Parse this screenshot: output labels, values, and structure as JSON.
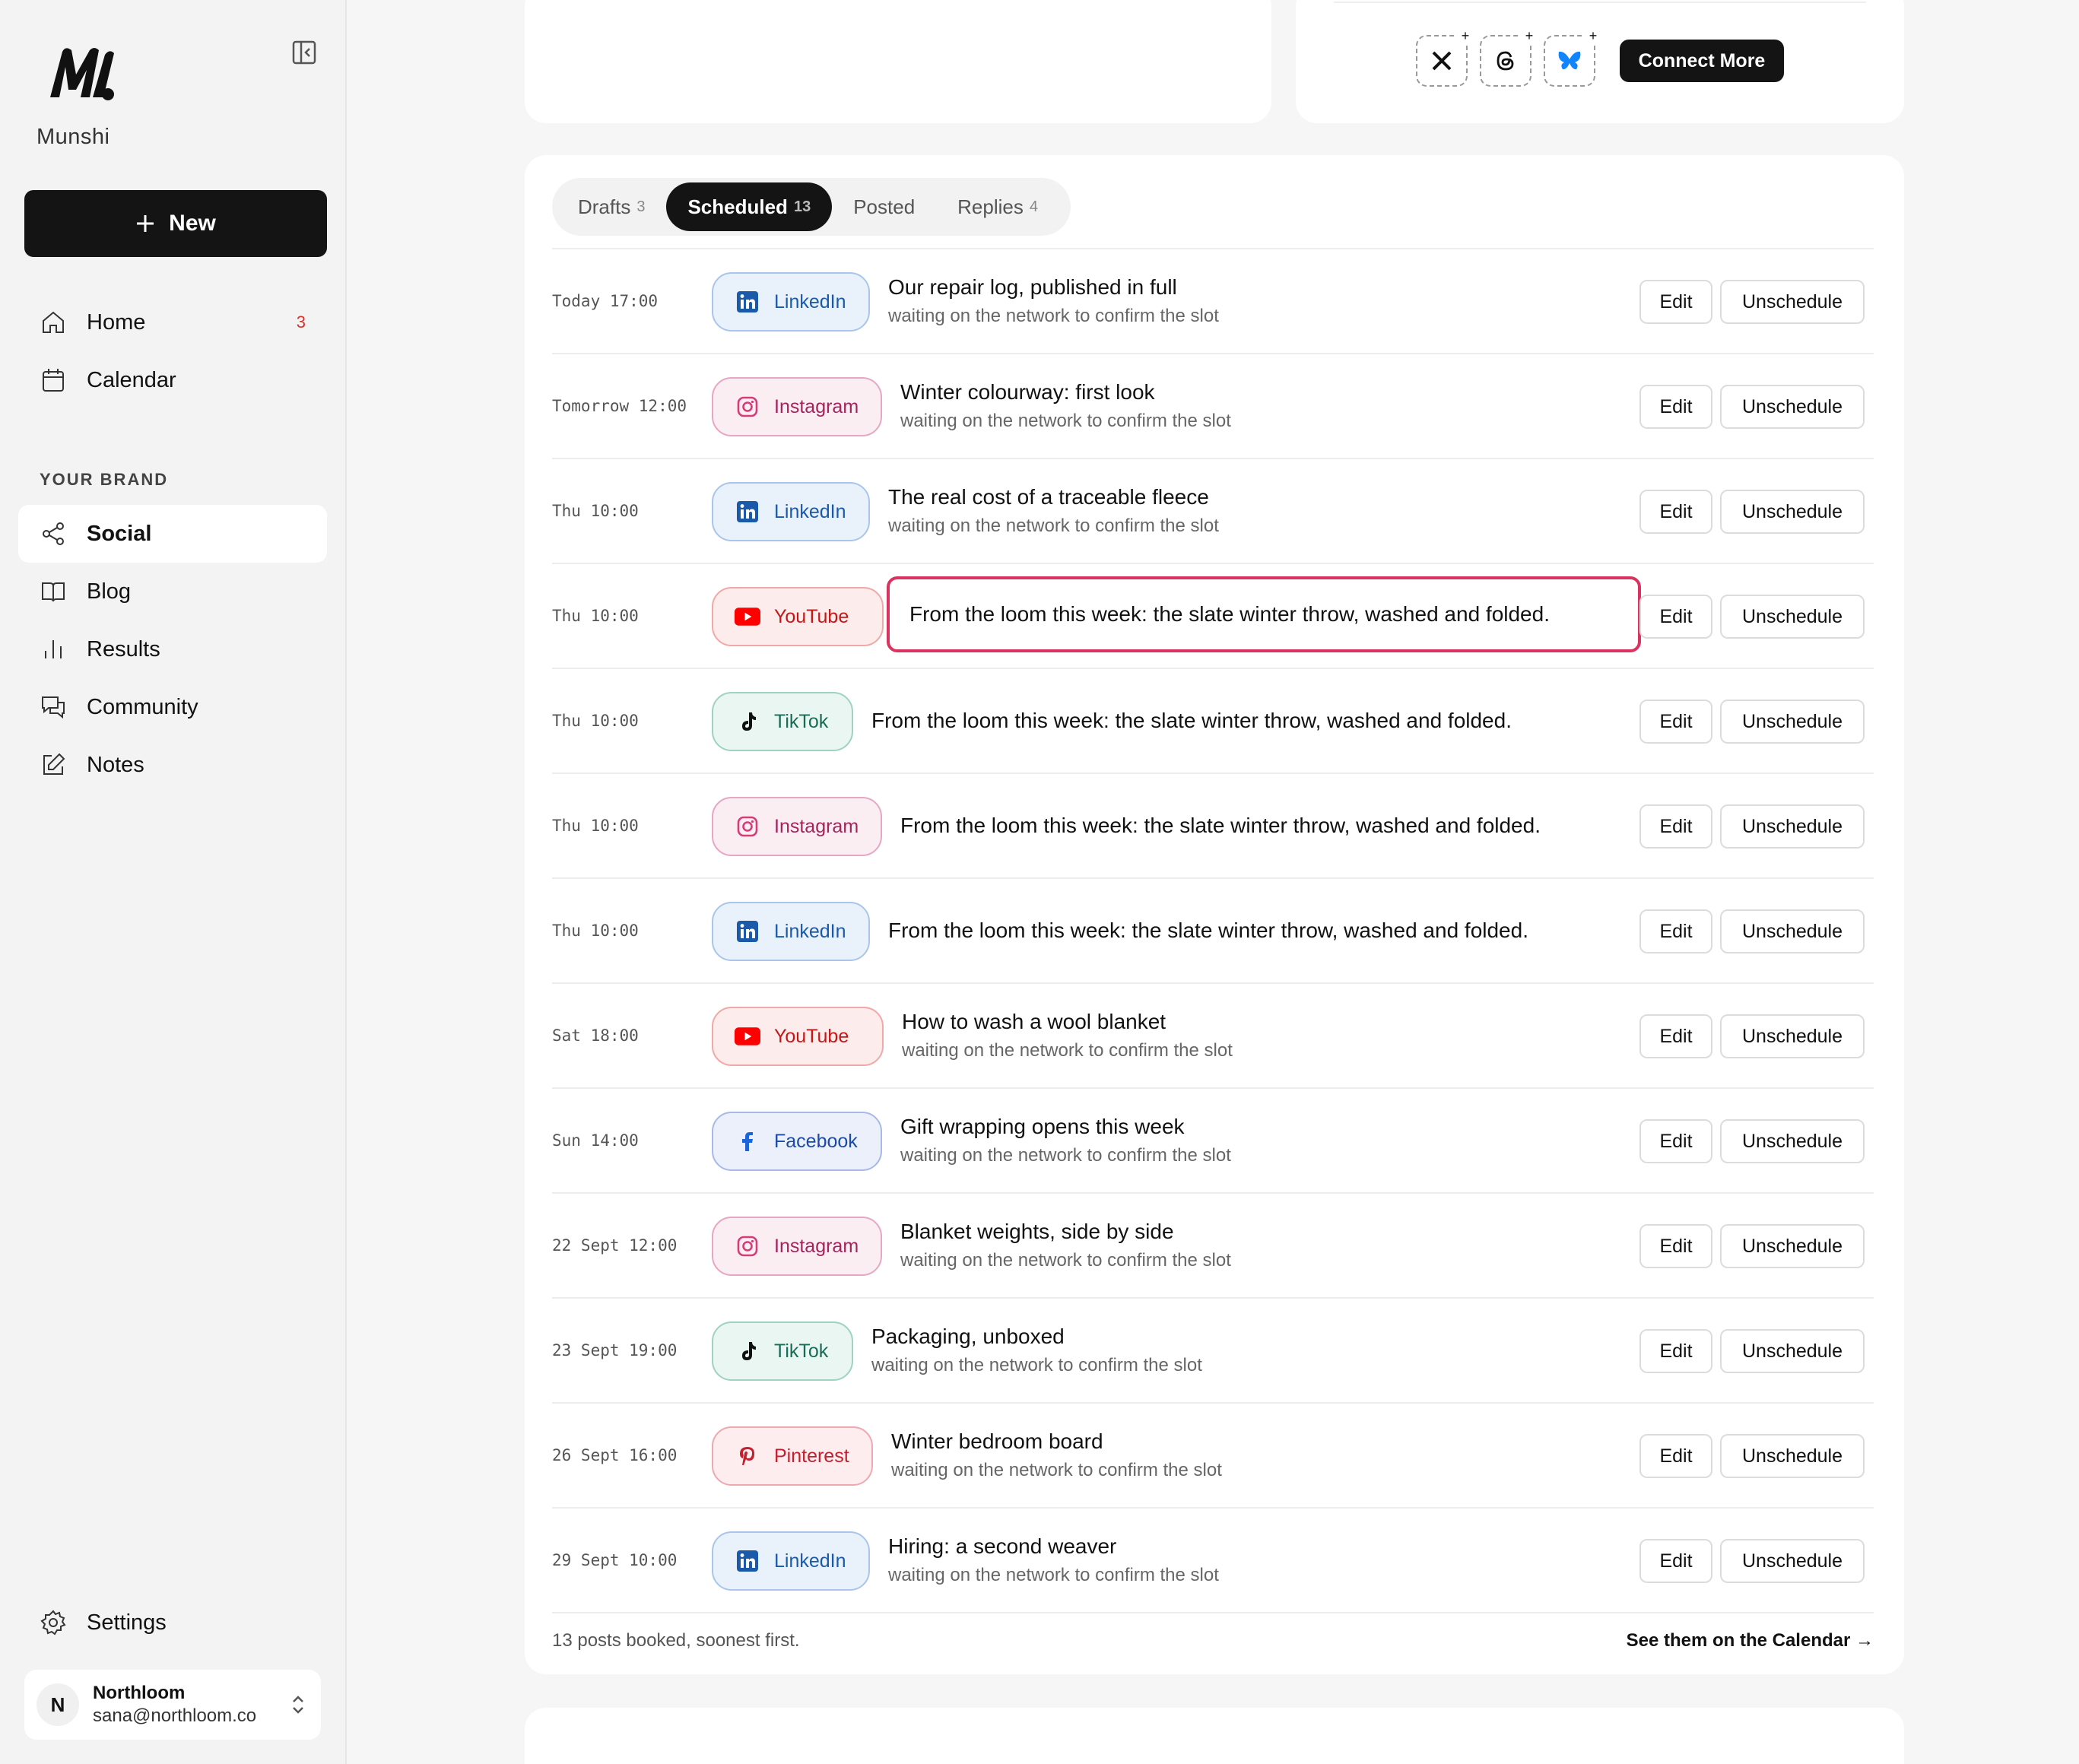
{
  "sidebar": {
    "brand": "Munshi",
    "new_label": "New",
    "nav": [
      {
        "label": "Home",
        "icon": "home-icon",
        "badge": "3"
      },
      {
        "label": "Calendar",
        "icon": "calendar-icon",
        "badge": ""
      }
    ],
    "section_label": "YOUR BRAND",
    "brand_nav": [
      {
        "label": "Social",
        "icon": "share-icon",
        "active": true
      },
      {
        "label": "Blog",
        "icon": "book-icon"
      },
      {
        "label": "Results",
        "icon": "bar-chart-icon"
      },
      {
        "label": "Community",
        "icon": "chat-icon"
      },
      {
        "label": "Notes",
        "icon": "edit-icon"
      }
    ],
    "settings_label": "Settings",
    "account": {
      "initial": "N",
      "name": "Northloom",
      "email": "sana@northloom.co"
    }
  },
  "connect": {
    "button_label": "Connect More",
    "slots": [
      "x-icon",
      "threads-icon",
      "bluesky-icon"
    ]
  },
  "tabs": [
    {
      "label": "Drafts",
      "count": "3"
    },
    {
      "label": "Scheduled",
      "count": "13",
      "active": true
    },
    {
      "label": "Posted",
      "count": ""
    },
    {
      "label": "Replies",
      "count": "4"
    }
  ],
  "rows": [
    {
      "time": "Today 17:00",
      "network": "LinkedIn",
      "title": "Our repair log, published in full",
      "sub": "waiting on the network to confirm the slot"
    },
    {
      "time": "Tomorrow 12:00",
      "network": "Instagram",
      "title": "Winter colourway: first look",
      "sub": "waiting on the network to confirm the slot"
    },
    {
      "time": "Thu 10:00",
      "network": "LinkedIn",
      "title": "The real cost of a traceable fleece",
      "sub": "waiting on the network to confirm the slot"
    },
    {
      "time": "Thu 10:00",
      "network": "YouTube",
      "title": "From the loom this week: the slate winter throw, washed and folded.",
      "sub": "",
      "highlighted": true
    },
    {
      "time": "Thu 10:00",
      "network": "TikTok",
      "title": "From the loom this week: the slate winter throw, washed and folded.",
      "sub": ""
    },
    {
      "time": "Thu 10:00",
      "network": "Instagram",
      "title": "From the loom this week: the slate winter throw, washed and folded.",
      "sub": ""
    },
    {
      "time": "Thu 10:00",
      "network": "LinkedIn",
      "title": "From the loom this week: the slate winter throw, washed and folded.",
      "sub": ""
    },
    {
      "time": "Sat 18:00",
      "network": "YouTube",
      "title": "How to wash a wool blanket",
      "sub": "waiting on the network to confirm the slot"
    },
    {
      "time": "Sun 14:00",
      "network": "Facebook",
      "title": "Gift wrapping opens this week",
      "sub": "waiting on the network to confirm the slot"
    },
    {
      "time": "22 Sept 12:00",
      "network": "Instagram",
      "title": "Blanket weights, side by side",
      "sub": "waiting on the network to confirm the slot"
    },
    {
      "time": "23 Sept 19:00",
      "network": "TikTok",
      "title": "Packaging, unboxed",
      "sub": "waiting on the network to confirm the slot"
    },
    {
      "time": "26 Sept 16:00",
      "network": "Pinterest",
      "title": "Winter bedroom board",
      "sub": "waiting on the network to confirm the slot"
    },
    {
      "time": "29 Sept 10:00",
      "network": "LinkedIn",
      "title": "Hiring: a second weaver",
      "sub": "waiting on the network to confirm the slot"
    }
  ],
  "row_actions": {
    "edit": "Edit",
    "unschedule": "Unschedule"
  },
  "footer": {
    "note": "13 posts booked, soonest first.",
    "link": "See them on the Calendar →"
  },
  "colors": {
    "accent_dark": "#141414",
    "highlight": "#d8345f",
    "badge": "#d9332f"
  }
}
